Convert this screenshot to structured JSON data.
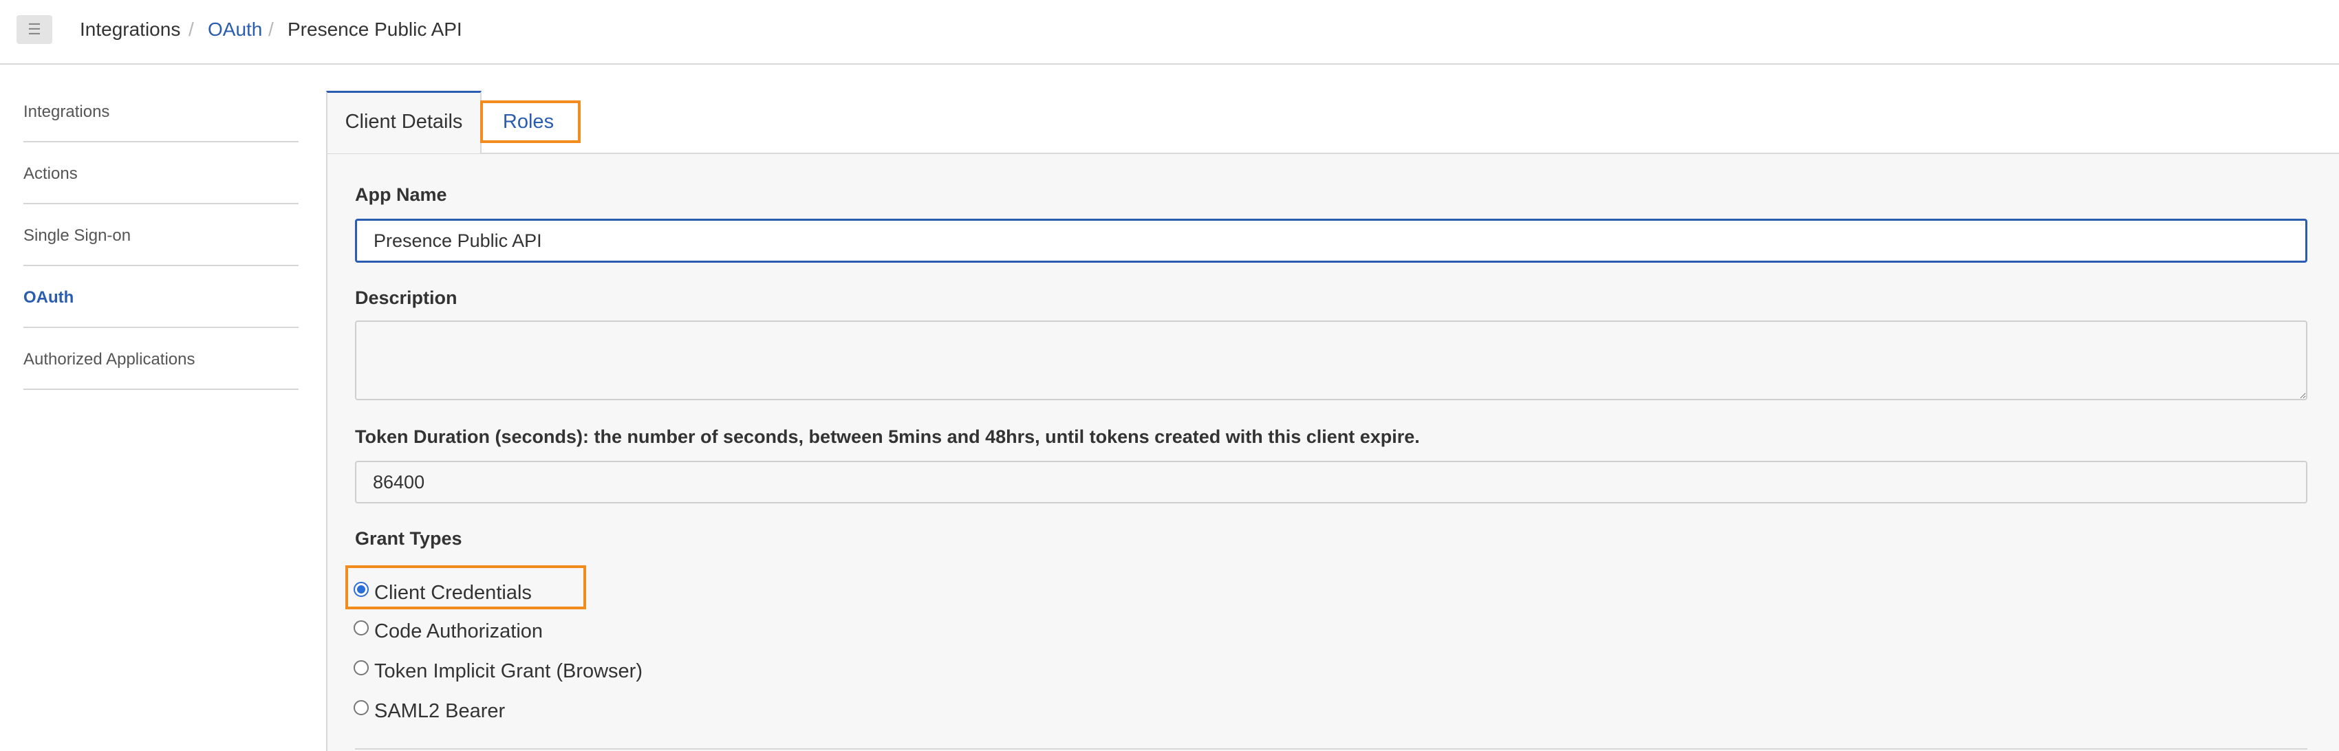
{
  "breadcrumb": {
    "items": [
      "Integrations",
      "OAuth",
      "Presence Public API"
    ],
    "separator": "/"
  },
  "menu_icon": "hamburger-menu-icon",
  "sidebar": {
    "items": [
      {
        "label": "Integrations",
        "active": false
      },
      {
        "label": "Actions",
        "active": false
      },
      {
        "label": "Single Sign-on",
        "active": false
      },
      {
        "label": "OAuth",
        "active": true
      },
      {
        "label": "Authorized Applications",
        "active": false
      }
    ]
  },
  "tabs": [
    {
      "label": "Client Details",
      "selected": true
    },
    {
      "label": "Roles",
      "selected": false
    }
  ],
  "form": {
    "app_name_label": "App Name",
    "app_name_value": "Presence Public API",
    "description_label": "Description",
    "description_value": "",
    "token_duration_label": "Token Duration (seconds): the number of seconds, between 5mins and 48hrs, until tokens created with this client expire.",
    "token_duration_value": "86400",
    "grant_types_label": "Grant Types",
    "grant_types": [
      {
        "label": "Client Credentials",
        "checked": true
      },
      {
        "label": "Code Authorization",
        "checked": false
      },
      {
        "label": "Token Implicit Grant (Browser)",
        "checked": false
      },
      {
        "label": "SAML2 Bearer",
        "checked": false
      }
    ]
  },
  "colors": {
    "accent": "#2a5db0",
    "highlight": "#f28c1e",
    "panel_bg": "#f7f7f7"
  }
}
